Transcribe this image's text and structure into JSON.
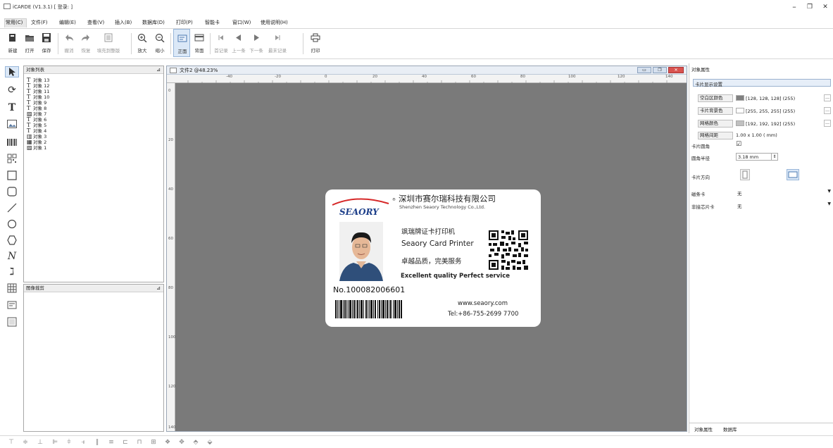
{
  "window": {
    "title": "iCARDE (V1.3.1)  [ 登录: ]",
    "controls": [
      "–",
      "❐",
      "✕"
    ]
  },
  "menu": [
    "常用(C)",
    "文件(F)",
    "编辑(E)",
    "查看(V)",
    "插入(B)",
    "数据库(D)",
    "打印(P)",
    "智能卡",
    "窗口(W)",
    "使用说明(H)"
  ],
  "toolbar": {
    "new": "新建",
    "open": "打开",
    "save": "保存",
    "undo": "撤消",
    "redo": "恢复",
    "fill": "填充到整版",
    "zoom_in": "放大",
    "zoom_out": "缩小",
    "front": "正面",
    "back": "背面",
    "first": "首记录",
    "prev": "上一条",
    "next": "下一条",
    "last": "最末记录",
    "print": "打印"
  },
  "object_panel": {
    "title": "对象列表",
    "items": [
      {
        "type": "T",
        "label": "对象 13"
      },
      {
        "type": "T",
        "label": "对象 12"
      },
      {
        "type": "T",
        "label": "对象 11"
      },
      {
        "type": "T",
        "label": "对象 10"
      },
      {
        "type": "T",
        "label": "对象 9"
      },
      {
        "type": "T",
        "label": "对象 8"
      },
      {
        "type": "img",
        "label": "对象 7"
      },
      {
        "type": "T",
        "label": "对象 6"
      },
      {
        "type": "T",
        "label": "对象 5"
      },
      {
        "type": "T",
        "label": "对象 4"
      },
      {
        "type": "bar",
        "label": "对象 3"
      },
      {
        "type": "qr",
        "label": "对象 2"
      },
      {
        "type": "img",
        "label": "对象 1"
      }
    ]
  },
  "image_panel": {
    "title": "图像裁剪"
  },
  "document": {
    "title": "文件2 @48.23%",
    "ruler_top": [
      "-40",
      "-20",
      "0",
      "20",
      "40",
      "60",
      "80",
      "100",
      "120",
      "140"
    ],
    "ruler_left": [
      "0",
      "20",
      "40",
      "60",
      "80",
      "100",
      "120",
      "140"
    ]
  },
  "card": {
    "company_cn": "深圳市赛尔瑞科技有限公司",
    "company_en": "Shenzhen Seaory Technology Co.,Ltd.",
    "brand": "SEAORY",
    "line1": "飒瑞牌证卡打印机",
    "line2": "Seaory Card Printer",
    "line3": "卓越品质，完美服务",
    "line4": "Excellent quality Perfect service",
    "number": "No.100082006601",
    "website": "www.seaory.com",
    "tel": "Tel:+86-755-2699 7700"
  },
  "properties": {
    "panel_title": "对象属性",
    "section": "卡片显示设置",
    "blank_color_label": "空白区颜色",
    "blank_color_value": "[128, 128, 128] (255)",
    "bg_color_label": "卡片背景色",
    "bg_color_value": "[255, 255, 255] (255)",
    "grid_color_label": "网格颜色",
    "grid_color_value": "[192, 192, 192] (255)",
    "grid_spacing_label": "网格间距",
    "grid_spacing_value": "1.00 x 1.00 ( mm)",
    "round_label": "卡片圆角",
    "round_checked": "☑",
    "radius_label": "圆角半径",
    "radius_value": "3.18 mm",
    "direction_label": "卡片方向",
    "mag_label": "磁条卡",
    "mag_value": "无",
    "chip_label": "非接芯片卡",
    "chip_value": "无",
    "tab1": "对象属性",
    "tab2": "数据库",
    "colors": {
      "blank": "#808080",
      "bg": "#ffffff",
      "grid": "#c0c0c0"
    }
  }
}
